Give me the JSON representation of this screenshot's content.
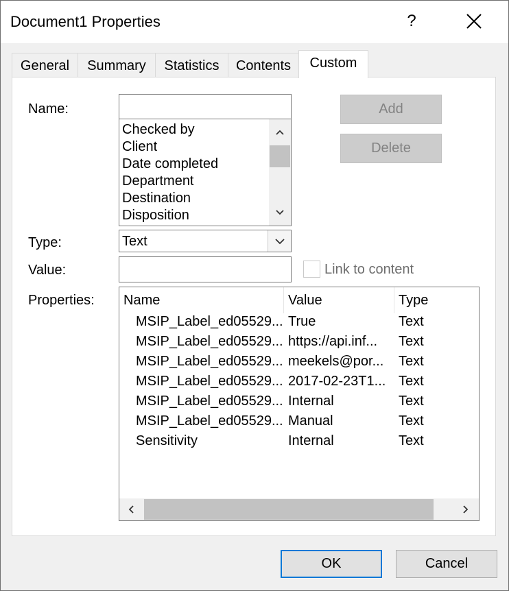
{
  "window": {
    "title": "Document1 Properties",
    "help_label": "?"
  },
  "tabs": [
    {
      "label": "General",
      "active": false
    },
    {
      "label": "Summary",
      "active": false
    },
    {
      "label": "Statistics",
      "active": false
    },
    {
      "label": "Contents",
      "active": false
    },
    {
      "label": "Custom",
      "active": true
    }
  ],
  "custom": {
    "name_label": "Name:",
    "name_value": "",
    "name_options": [
      "Checked by",
      "Client",
      "Date completed",
      "Department",
      "Destination",
      "Disposition"
    ],
    "add_label": "Add",
    "delete_label": "Delete",
    "type_label": "Type:",
    "type_value": "Text",
    "value_label": "Value:",
    "value_value": "",
    "link_label": "Link to content",
    "link_checked": false,
    "properties_label": "Properties:",
    "columns": {
      "name": "Name",
      "value": "Value",
      "type": "Type"
    },
    "rows": [
      {
        "name": "MSIP_Label_ed05529...",
        "value": "True",
        "type": "Text"
      },
      {
        "name": "MSIP_Label_ed05529...",
        "value": "https://api.inf...",
        "type": "Text"
      },
      {
        "name": "MSIP_Label_ed05529...",
        "value": "meekels@por...",
        "type": "Text"
      },
      {
        "name": "MSIP_Label_ed05529...",
        "value": "2017-02-23T1...",
        "type": "Text"
      },
      {
        "name": "MSIP_Label_ed05529...",
        "value": "Internal",
        "type": "Text"
      },
      {
        "name": "MSIP_Label_ed05529...",
        "value": "Manual",
        "type": "Text"
      },
      {
        "name": "Sensitivity",
        "value": "Internal",
        "type": "Text"
      }
    ]
  },
  "footer": {
    "ok_label": "OK",
    "cancel_label": "Cancel"
  },
  "colors": {
    "accent": "#0078d7",
    "disabled_button": "#cccccc",
    "scroll_thumb": "#c2c2c2"
  }
}
